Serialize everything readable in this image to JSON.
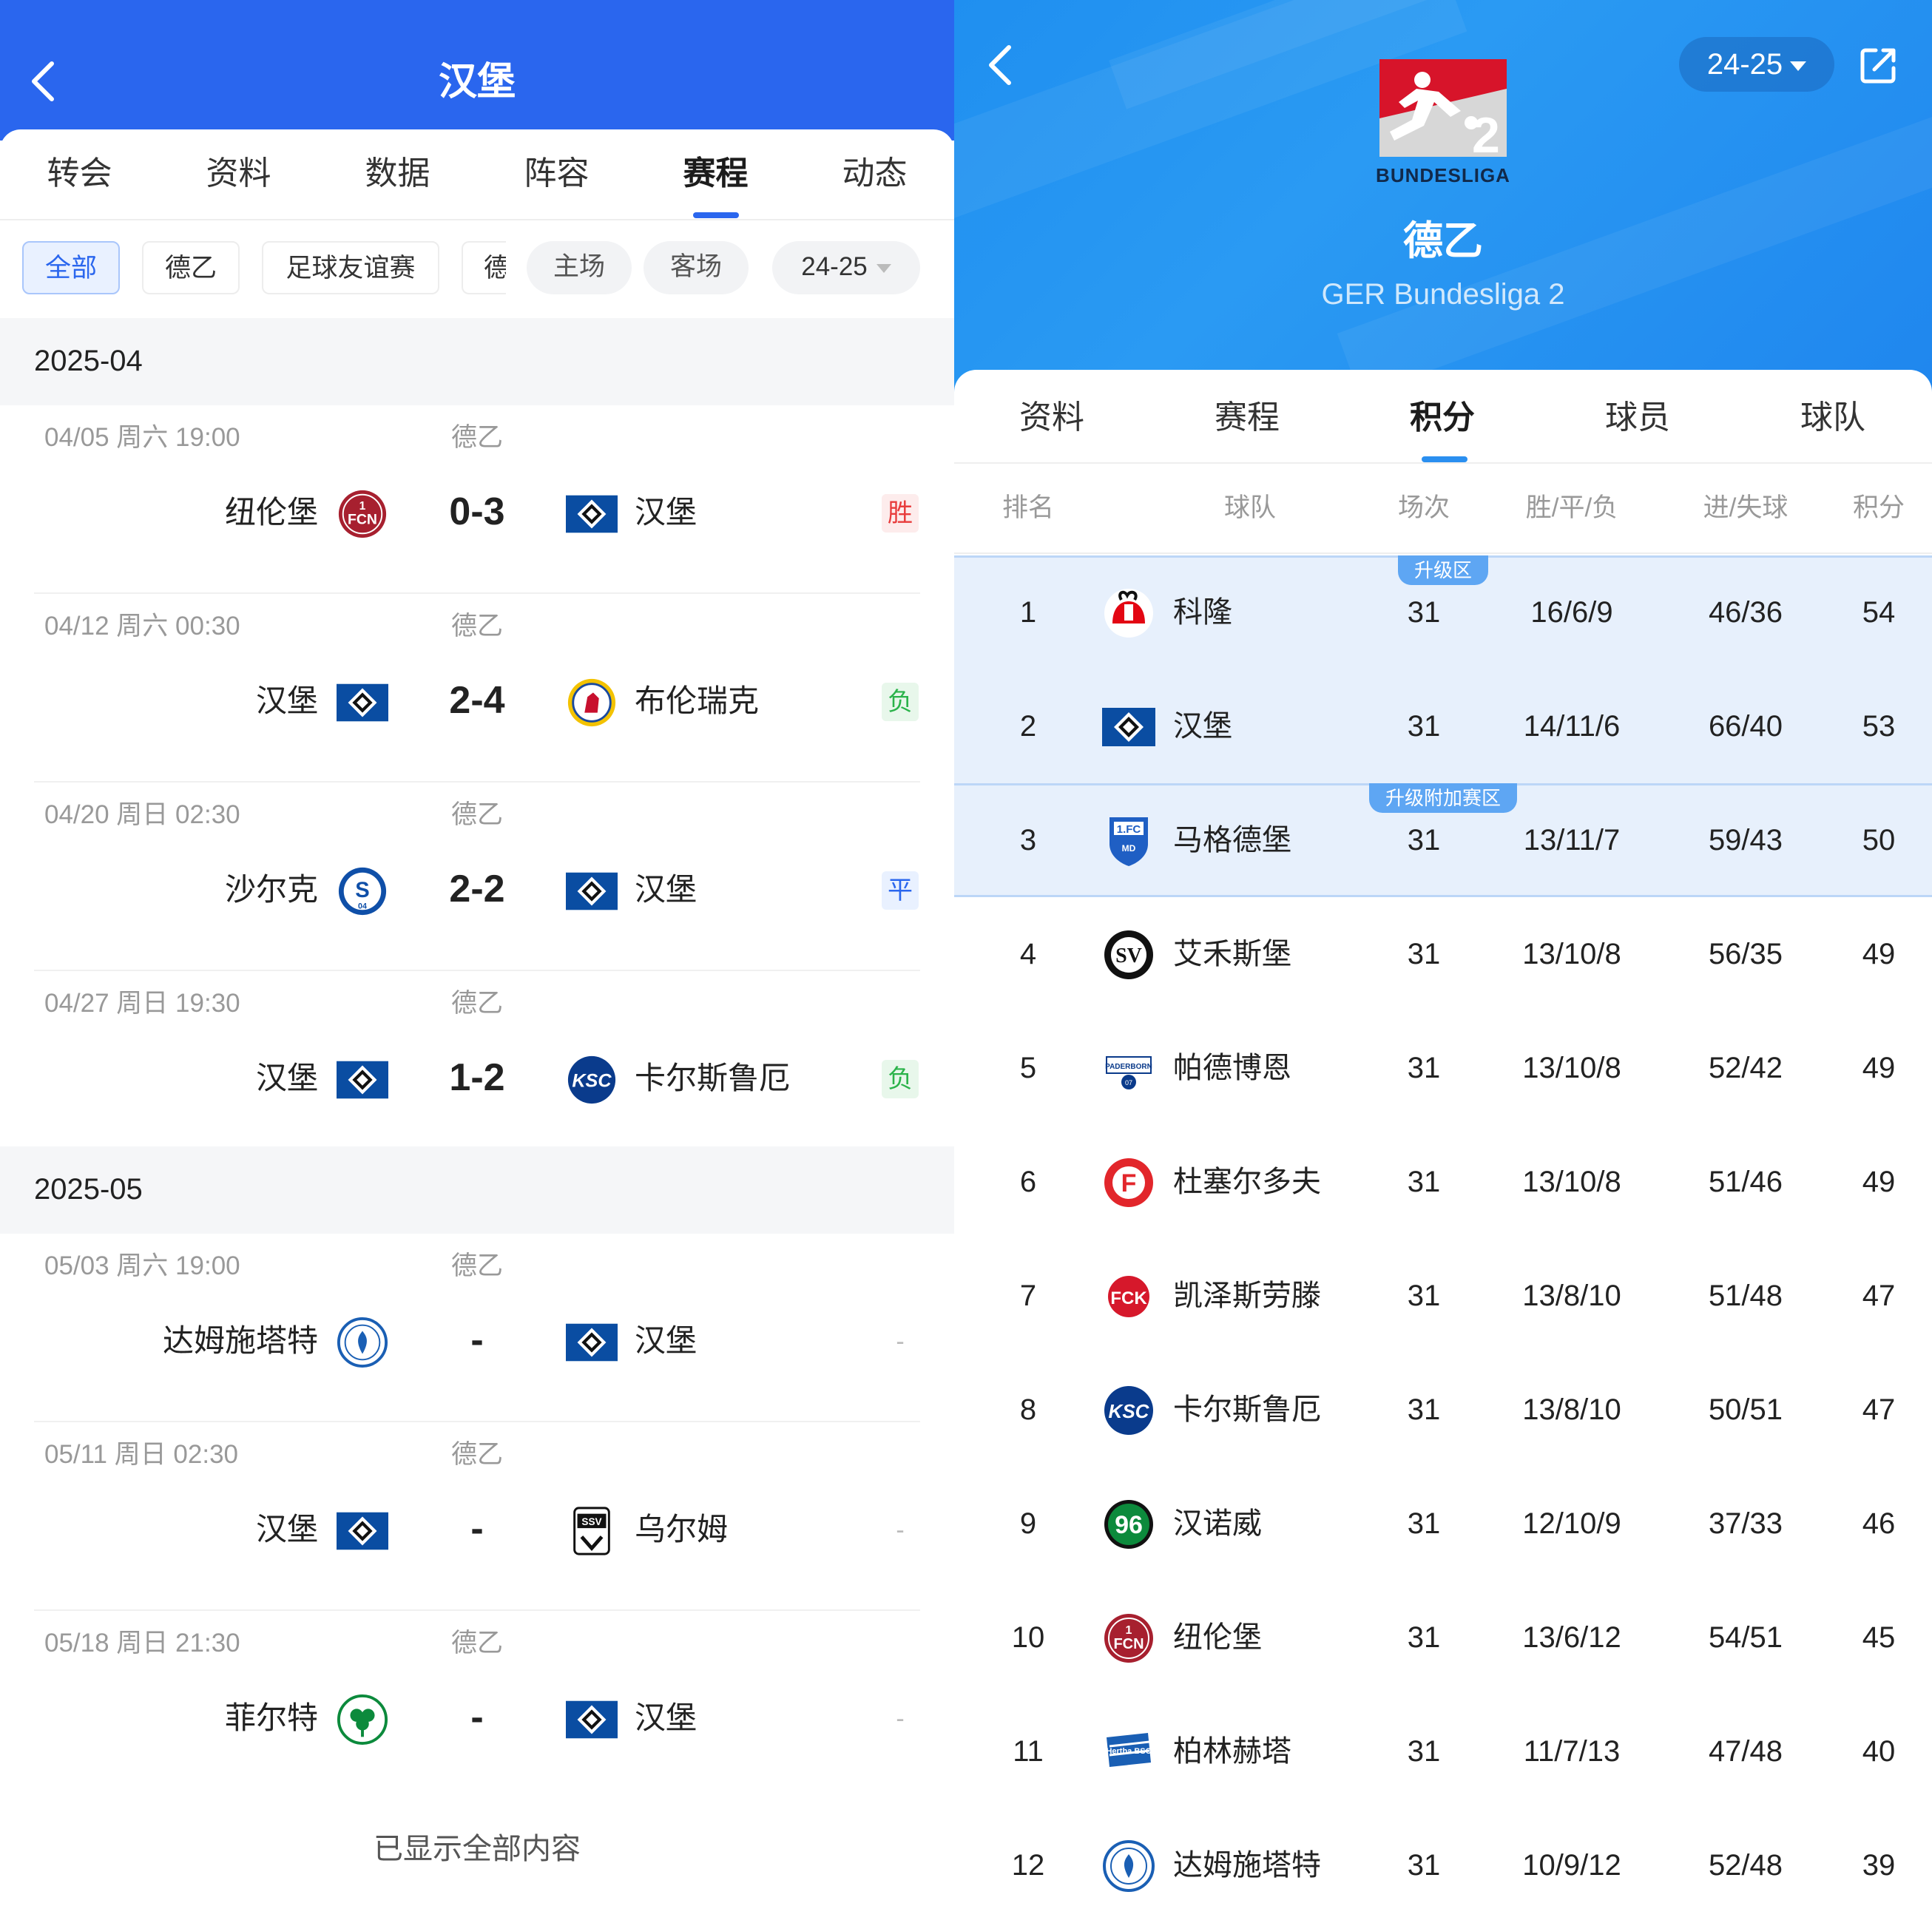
{
  "left": {
    "title": "汉堡",
    "tabs": [
      {
        "label": "转会"
      },
      {
        "label": "资料"
      },
      {
        "label": "数据"
      },
      {
        "label": "阵容"
      },
      {
        "label": "赛程"
      },
      {
        "label": "动态"
      }
    ],
    "active_tab": "赛程",
    "filters": {
      "all": "全部",
      "league": "德乙",
      "friendly": "足球友谊赛",
      "truncated": "德",
      "home": "主场",
      "away": "客场",
      "season": "24-25"
    },
    "months": [
      {
        "label": "2025-04",
        "matches": [
          {
            "date": "04/05 周六 19:00",
            "comp": "德乙",
            "home": "纽伦堡",
            "home_logo": "fcn",
            "score": "0-3",
            "away": "汉堡",
            "away_logo": "hsv",
            "result": "胜",
            "result_type": "win"
          },
          {
            "date": "04/12 周六 00:30",
            "comp": "德乙",
            "home": "汉堡",
            "home_logo": "hsv",
            "score": "2-4",
            "away": "布伦瑞克",
            "away_logo": "braunschweig",
            "result": "负",
            "result_type": "loss"
          },
          {
            "date": "04/20 周日 02:30",
            "comp": "德乙",
            "home": "沙尔克",
            "home_logo": "schalke",
            "score": "2-2",
            "away": "汉堡",
            "away_logo": "hsv",
            "result": "平",
            "result_type": "draw"
          },
          {
            "date": "04/27 周日 19:30",
            "comp": "德乙",
            "home": "汉堡",
            "home_logo": "hsv",
            "score": "1-2",
            "away": "卡尔斯鲁厄",
            "away_logo": "ksc",
            "result": "负",
            "result_type": "loss"
          }
        ]
      },
      {
        "label": "2025-05",
        "matches": [
          {
            "date": "05/03 周六 19:00",
            "comp": "德乙",
            "home": "达姆施塔特",
            "home_logo": "darmstadt",
            "score": "-",
            "away": "汉堡",
            "away_logo": "hsv",
            "result": "-",
            "result_type": "none"
          },
          {
            "date": "05/11 周日 02:30",
            "comp": "德乙",
            "home": "汉堡",
            "home_logo": "hsv",
            "score": "-",
            "away": "乌尔姆",
            "away_logo": "ulm",
            "result": "-",
            "result_type": "none"
          },
          {
            "date": "05/18 周日 21:30",
            "comp": "德乙",
            "home": "菲尔特",
            "home_logo": "fuerth",
            "score": "-",
            "away": "汉堡",
            "away_logo": "hsv",
            "result": "-",
            "result_type": "none"
          }
        ]
      }
    ],
    "footer": "已显示全部内容"
  },
  "right": {
    "season": "24-25",
    "logo_text": "BUNDESLIGA",
    "league_name": "德乙",
    "league_sub": "GER Bundesliga 2",
    "tabs": [
      {
        "label": "资料"
      },
      {
        "label": "赛程"
      },
      {
        "label": "积分"
      },
      {
        "label": "球员"
      },
      {
        "label": "球队"
      }
    ],
    "active_tab": "积分",
    "headers": {
      "rank": "排名",
      "team": "球队",
      "played": "场次",
      "wdl": "胜/平/负",
      "goals": "进/失球",
      "points": "积分"
    },
    "zones": {
      "promotion": "升级区",
      "playoff": "升级附加赛区"
    },
    "rows": [
      {
        "rank": "1",
        "team": "科隆",
        "logo": "koeln",
        "played": "31",
        "wdl": "16/6/9",
        "goals": "46/36",
        "points": "54",
        "zone": "promotion"
      },
      {
        "rank": "2",
        "team": "汉堡",
        "logo": "hsv",
        "played": "31",
        "wdl": "14/11/6",
        "goals": "66/40",
        "points": "53",
        "zone": "promotion"
      },
      {
        "rank": "3",
        "team": "马格德堡",
        "logo": "magdeburg",
        "played": "31",
        "wdl": "13/11/7",
        "goals": "59/43",
        "points": "50",
        "zone": "playoff"
      },
      {
        "rank": "4",
        "team": "艾禾斯堡",
        "logo": "elversberg",
        "played": "31",
        "wdl": "13/10/8",
        "goals": "56/35",
        "points": "49",
        "zone": ""
      },
      {
        "rank": "5",
        "team": "帕德博恩",
        "logo": "paderborn",
        "played": "31",
        "wdl": "13/10/8",
        "goals": "52/42",
        "points": "49",
        "zone": ""
      },
      {
        "rank": "6",
        "team": "杜塞尔多夫",
        "logo": "duesseldorf",
        "played": "31",
        "wdl": "13/10/8",
        "goals": "51/46",
        "points": "49",
        "zone": ""
      },
      {
        "rank": "7",
        "team": "凯泽斯劳滕",
        "logo": "kaiserslautern",
        "played": "31",
        "wdl": "13/8/10",
        "goals": "51/48",
        "points": "47",
        "zone": ""
      },
      {
        "rank": "8",
        "team": "卡尔斯鲁厄",
        "logo": "ksc",
        "played": "31",
        "wdl": "13/8/10",
        "goals": "50/51",
        "points": "47",
        "zone": ""
      },
      {
        "rank": "9",
        "team": "汉诺威",
        "logo": "hannover",
        "played": "31",
        "wdl": "12/10/9",
        "goals": "37/33",
        "points": "46",
        "zone": ""
      },
      {
        "rank": "10",
        "team": "纽伦堡",
        "logo": "fcn",
        "played": "31",
        "wdl": "13/6/12",
        "goals": "54/51",
        "points": "45",
        "zone": ""
      },
      {
        "rank": "11",
        "team": "柏林赫塔",
        "logo": "hertha",
        "played": "31",
        "wdl": "11/7/13",
        "goals": "47/48",
        "points": "40",
        "zone": ""
      },
      {
        "rank": "12",
        "team": "达姆施塔特",
        "logo": "darmstadt",
        "played": "31",
        "wdl": "10/9/12",
        "goals": "52/48",
        "points": "39",
        "zone": ""
      }
    ]
  },
  "colors": {
    "brand_blue": "#2a66ee",
    "league_blue": "#2a8ff0",
    "win": "#e83c3c",
    "loss": "#2bb34a",
    "draw": "#2a66ee"
  }
}
